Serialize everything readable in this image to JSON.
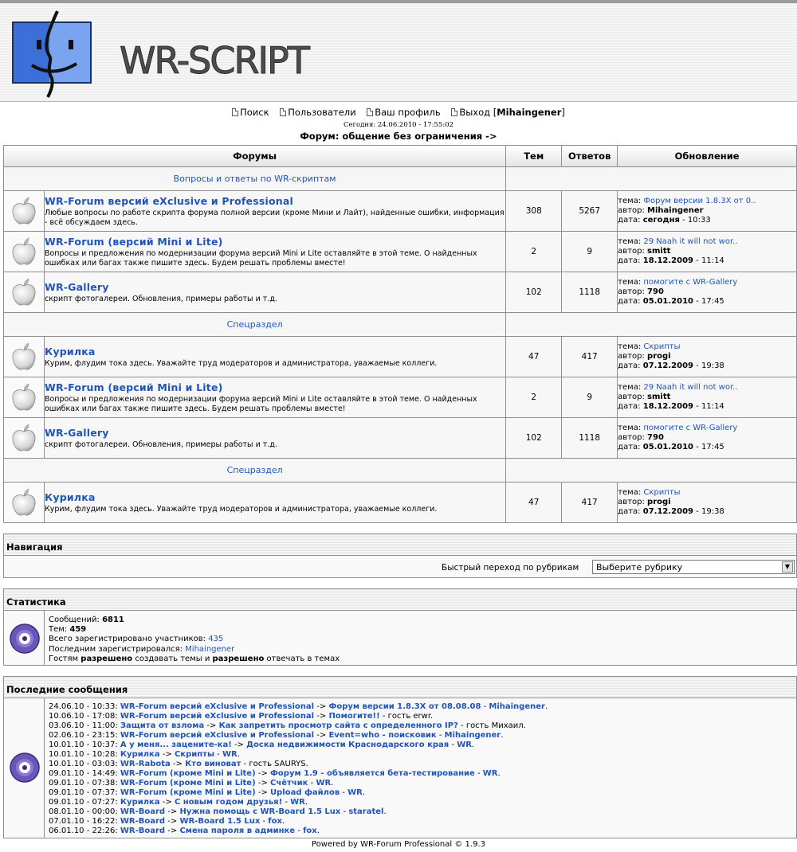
{
  "header": {
    "logo_text": "WR-SCRIPT"
  },
  "menu": {
    "search": "Поиск",
    "users": "Пользователи",
    "profile": "Ваш профиль",
    "logout": "Выход",
    "username": "Mihaingener"
  },
  "today_line": "Сегодня: 24.06.2010 - 17:55:02",
  "forum_title": "Форум: общение без ограничения ->",
  "table_headers": {
    "forums": "Форумы",
    "topics": "Тем",
    "replies": "Ответов",
    "updated": "Обновление"
  },
  "labels": {
    "topic": "тема:",
    "author": "автор:",
    "date": "дата:"
  },
  "sections": [
    {
      "title": "Вопросы и ответы по WR-скриптам",
      "forums": [
        {
          "name": "WR-Forum версий eXclusive и Professional",
          "desc": "Любые вопросы по работе скрипта форума полной версии (кроме Мини и Лайт), найденные ошибки, информация - всё обсуждаем здесь.",
          "topics": "308",
          "replies": "5267",
          "last_topic": "Форум версии 1.8.3X от 0..",
          "last_author": "Mihaingener",
          "last_date": "сегодня",
          "last_time": "10:33"
        },
        {
          "name": "WR-Forum (версий Mini и Lite)",
          "desc": "Вопросы и предложения по модернизации форума версий Mini и Lite оставляйте в этой теме. О найденных ошибках или багах также пишите здесь. Будем решать проблемы вместе!",
          "topics": "2",
          "replies": "9",
          "last_topic": "29 Naah it will not wor..",
          "last_author": "smitt",
          "last_date": "18.12.2009",
          "last_time": "11:14"
        },
        {
          "name": "WR-Gallery",
          "desc": "скрипт фотогалереи. Обновления, примеры работы и т.д.",
          "topics": "102",
          "replies": "1118",
          "last_topic": "помогите с WR-Gallery",
          "last_author": "790",
          "last_date": "05.01.2010",
          "last_time": "17:45"
        }
      ]
    },
    {
      "title": "Спецраздел",
      "forums": [
        {
          "name": "Курилка",
          "desc": "Курим, флудим тока здесь. Уважайте труд модераторов и администратора, уважаемые коллеги.",
          "topics": "47",
          "replies": "417",
          "last_topic": "Скрипты",
          "last_author": "progi",
          "last_date": "07.12.2009",
          "last_time": "19:38"
        },
        {
          "name": "WR-Forum (версий Mini и Lite)",
          "desc": "Вопросы и предложения по модернизации форума версий Mini и Lite оставляйте в этой теме. О найденных ошибках или багах также пишите здесь. Будем решать проблемы вместе!",
          "topics": "2",
          "replies": "9",
          "last_topic": "29 Naah it will not wor..",
          "last_author": "smitt",
          "last_date": "18.12.2009",
          "last_time": "11:14"
        },
        {
          "name": "WR-Gallery",
          "desc": "скрипт фотогалереи. Обновления, примеры работы и т.д.",
          "topics": "102",
          "replies": "1118",
          "last_topic": "помогите с WR-Gallery",
          "last_author": "790",
          "last_date": "05.01.2010",
          "last_time": "17:45"
        }
      ]
    },
    {
      "title": "Спецраздел",
      "forums": [
        {
          "name": "Курилка",
          "desc": "Курим, флудим тока здесь. Уважайте труд модераторов и администратора, уважаемые коллеги.",
          "topics": "47",
          "replies": "417",
          "last_topic": "Скрипты",
          "last_author": "progi",
          "last_date": "07.12.2009",
          "last_time": "19:38"
        }
      ]
    }
  ],
  "navigation": {
    "title": "Навигация",
    "quick_jump_label": "Быстрый переход по рубрикам",
    "select_value": "Выберите рубрику"
  },
  "stats": {
    "title": "Статистика",
    "messages_label": "Сообщений:",
    "messages": "6811",
    "topics_label": "Тем:",
    "topics": "459",
    "members_label": "Всего зарегистрировано участников:",
    "members": "435",
    "last_reg_label": "Последним зарегистрировался:",
    "last_reg": "Mihaingener",
    "guests_1": "Гостям",
    "guests_2": "разрешено",
    "guests_3": "создавать темы и",
    "guests_4": "разрешено",
    "guests_5": "отвечать в темах"
  },
  "recent": {
    "title": "Последние сообщения",
    "items": [
      {
        "date": "24.06.10 - 10:33:",
        "forum": "WR-Forum версий eXclusive и Professional",
        "topic": "Форум версии 1.8.3X от 08.08.08",
        "author": "Mihaingener",
        "guest": false
      },
      {
        "date": "10.06.10 - 17:08:",
        "forum": "WR-Forum версий eXclusive и Professional",
        "topic": "Помогите!!",
        "author": "гость erwr.",
        "guest": true
      },
      {
        "date": "03.06.10 - 11:00:",
        "forum": "Защита от взлома",
        "topic": "Как запретить просмотр сайта с определенного IP?",
        "author": "гость Михаил.",
        "guest": true
      },
      {
        "date": "02.06.10 - 23:15:",
        "forum": "WR-Forum версий eXclusive и Professional",
        "topic": "Event=who - поисковик",
        "author": "Mihaingener",
        "guest": false
      },
      {
        "date": "10.01.10 - 10:37:",
        "forum": "А у меня... заценитe-ка!",
        "topic": "Доска недвижимости Краснодарского края",
        "author": "WR",
        "guest": false
      },
      {
        "date": "10.01.10 - 10:28:",
        "forum": "Курилка",
        "topic": "Скрипты",
        "author": "WR",
        "guest": false
      },
      {
        "date": "10.01.10 - 03:03:",
        "forum": "WR-Rabota",
        "topic": "Кто виноват",
        "author": "гость SAURYS.",
        "guest": true
      },
      {
        "date": "09.01.10 - 14:49:",
        "forum": "WR-Forum (кроме Mini и Lite)",
        "topic": "Форум 1.9 - объявляется бета-тестирование",
        "author": "WR",
        "guest": false
      },
      {
        "date": "09.01.10 - 07:38:",
        "forum": "WR-Forum (кроме Mini и Lite)",
        "topic": "Счётчик",
        "author": "WR",
        "guest": false
      },
      {
        "date": "09.01.10 - 07:37:",
        "forum": "WR-Forum (кроме Mini и Lite)",
        "topic": "Upload файлов",
        "author": "WR",
        "guest": false
      },
      {
        "date": "09.01.10 - 07:27:",
        "forum": "Курилка",
        "topic": "С новым годом друзья!",
        "author": "WR",
        "guest": false
      },
      {
        "date": "08.01.10 - 00:00:",
        "forum": "WR-Board",
        "topic": "Нужна помощь с WR-Board 1.5 Lux",
        "author": "staratel",
        "guest": false
      },
      {
        "date": "07.01.10 - 16:22:",
        "forum": "WR-Board",
        "topic": "WR-Board 1.5 Lux",
        "author": "fox",
        "guest": false
      },
      {
        "date": "06.01.10 - 22:26:",
        "forum": "WR-Board",
        "topic": "Смена пароля в админке",
        "author": "fox",
        "guest": false
      }
    ]
  },
  "footer": "Powered by WR-Forum Professional © 1.9.3"
}
